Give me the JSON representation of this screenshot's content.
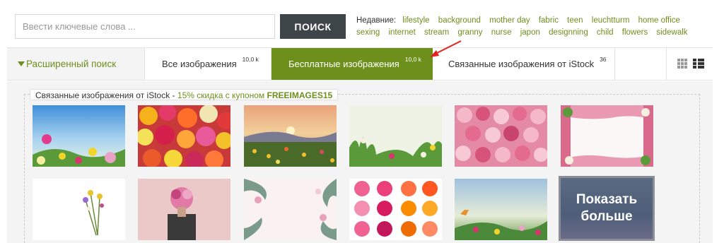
{
  "search": {
    "placeholder": "Ввести ключевые слова ...",
    "button_label": "ПОИСК"
  },
  "recent": {
    "label": "Недавние:",
    "items": [
      "lifestyle",
      "background",
      "mother day",
      "fabric",
      "teen",
      "leuchtturm",
      "home office",
      "sexing",
      "internet",
      "stream",
      "granny",
      "nurse",
      "japon",
      "designning",
      "child",
      "flowers",
      "sidewalk"
    ]
  },
  "tabs": {
    "advanced": "Расширенный поиск",
    "all": {
      "label": "Все изображения",
      "count": "10,0 k"
    },
    "free": {
      "label": "Бесплатные изображения",
      "count": "10,0 k"
    },
    "istock": {
      "label": "Связанные изображения от iStock",
      "count": "36"
    }
  },
  "promo": {
    "text": "Связанные изображения от iStock -",
    "discount": "15% скидка с купоном",
    "code": "FREEIMAGES15"
  },
  "more_button": "Показать больше",
  "colors": {
    "accent": "#6d8f1c",
    "search_button": "#3d4549",
    "panel_bg": "#f4f4f4"
  },
  "thumbnails": [
    {
      "name": "thumb-wildflowers-sky"
    },
    {
      "name": "thumb-colorful-gerberas"
    },
    {
      "name": "thumb-sunset-meadow"
    },
    {
      "name": "thumb-green-meadow"
    },
    {
      "name": "thumb-pink-roses-wall"
    },
    {
      "name": "thumb-flower-frame"
    },
    {
      "name": "thumb-wildflower-bouquet"
    },
    {
      "name": "thumb-woman-with-bouquet"
    },
    {
      "name": "thumb-leaf-frame"
    },
    {
      "name": "thumb-gerbera-set"
    },
    {
      "name": "thumb-butterfly-meadow"
    }
  ]
}
